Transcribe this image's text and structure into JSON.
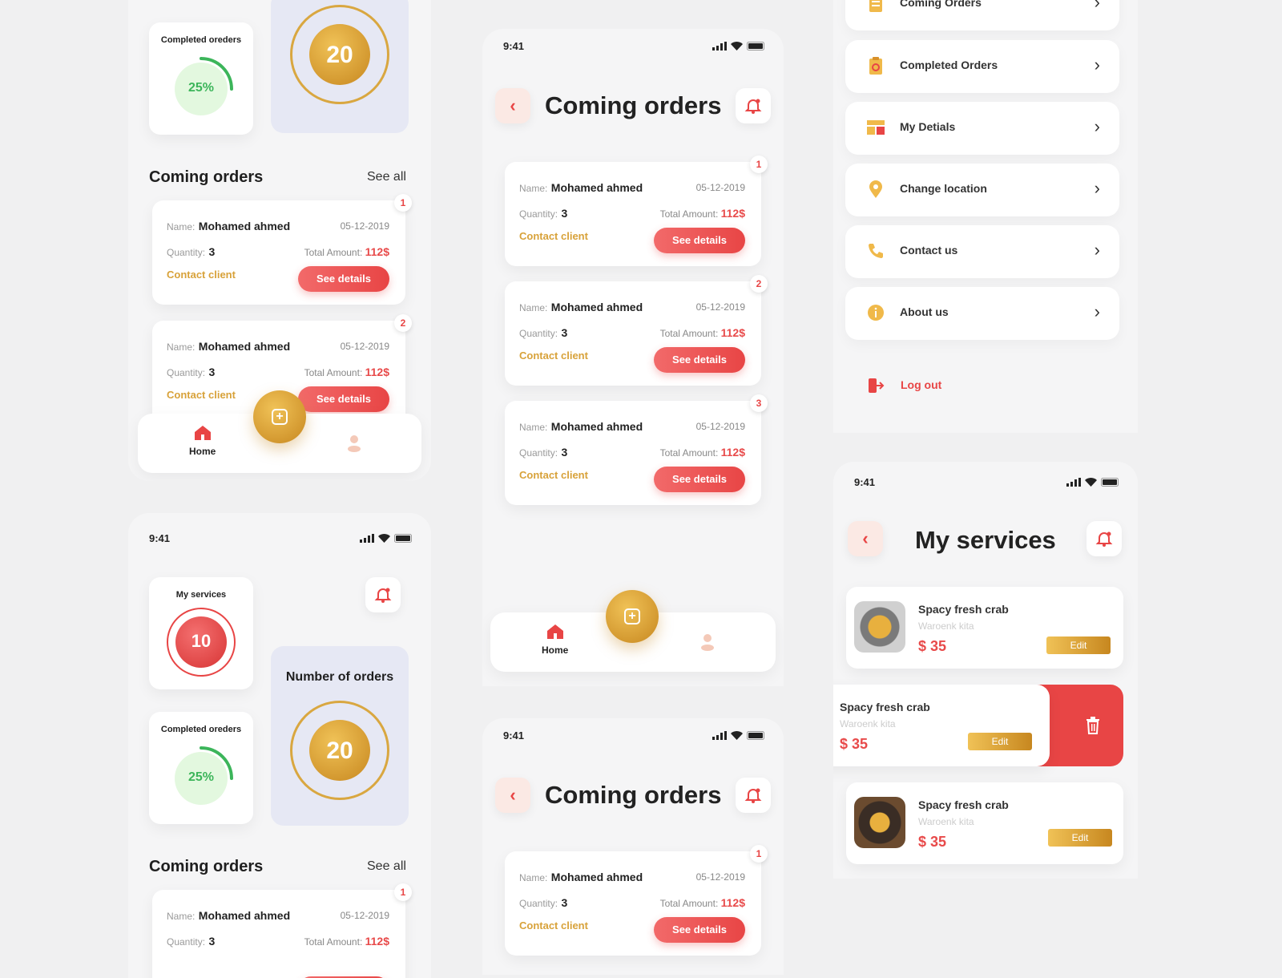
{
  "colors": {
    "accent_red": "#e84545",
    "accent_gold": "#d8a23a",
    "stat_panel": "#e6e8f4",
    "progress_green": "#3cb55a"
  },
  "status": {
    "time": "9:41"
  },
  "dashboard": {
    "my_services_label": "My services",
    "my_services_count": "10",
    "completed_label": "Completed oreders",
    "completed_percent": "25%",
    "completed_fraction": 0.25,
    "number_of_orders_label": "Number of orders",
    "number_of_orders": "20",
    "coming_orders_heading": "Coming orders",
    "see_all": "See all"
  },
  "order": {
    "name_label": "Name:",
    "name": "Mohamed ahmed",
    "date": "05-12-2019",
    "qty_label": "Quantity:",
    "qty": "3",
    "total_label": "Total Amount:",
    "total": "112$",
    "contact": "Contact client",
    "details": "See details"
  },
  "badges": [
    "1",
    "2",
    "3"
  ],
  "nav": {
    "home": "Home"
  },
  "coming_screen": {
    "title": "Coming orders"
  },
  "menu": {
    "items": [
      "Coming Orders",
      "Completed Orders",
      "My Detials",
      "Change location",
      "Contact us",
      "About us"
    ],
    "logout": "Log out"
  },
  "services": {
    "title": "My services",
    "item_name": "Spacy fresh crab",
    "item_sub": "Waroenk kita",
    "item_price": "$ 35",
    "edit": "Edit"
  }
}
